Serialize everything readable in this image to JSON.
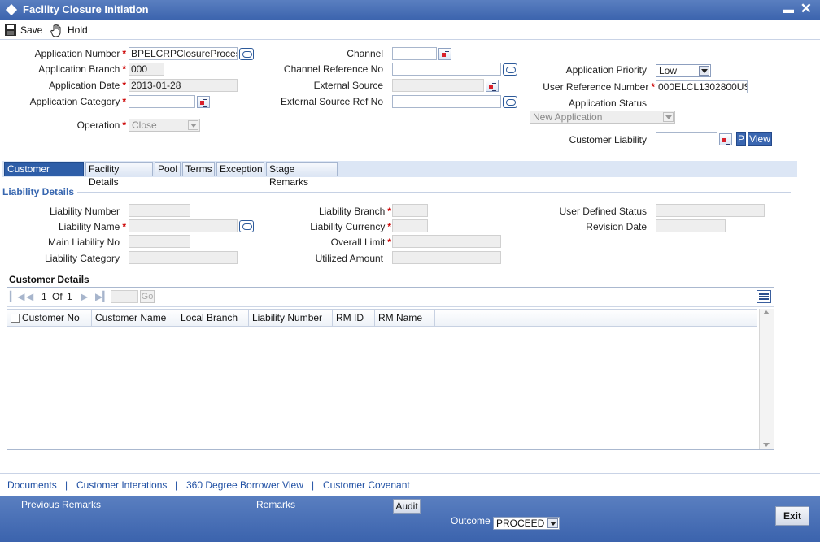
{
  "window": {
    "title": "Facility Closure Initiation"
  },
  "toolbar": {
    "save": "Save",
    "hold": "Hold"
  },
  "form": {
    "application_number": {
      "label": "Application Number",
      "value": "BPELCRPClosureProces"
    },
    "application_branch": {
      "label": "Application Branch",
      "value": "000"
    },
    "application_date": {
      "label": "Application Date",
      "value": "2013-01-28"
    },
    "application_category": {
      "label": "Application Category",
      "value": ""
    },
    "operation": {
      "label": "Operation",
      "value": "Close"
    },
    "channel": {
      "label": "Channel",
      "value": ""
    },
    "channel_reference_no": {
      "label": "Channel Reference No",
      "value": ""
    },
    "external_source": {
      "label": "External Source",
      "value": ""
    },
    "external_source_ref_no": {
      "label": "External Source Ref No",
      "value": ""
    },
    "application_priority": {
      "label": "Application Priority",
      "value": "Low"
    },
    "user_reference_number": {
      "label": "User Reference Number",
      "value": "000ELCL1302800US"
    },
    "application_status": {
      "label": "Application Status",
      "value": "New Application"
    },
    "customer_liability": {
      "label": "Customer Liability",
      "value": "",
      "p_button": "P",
      "view_button": "View"
    }
  },
  "tabs": [
    "Customer Details",
    "Facility Details",
    "Pool",
    "Terms",
    "Exception",
    "Stage Remarks"
  ],
  "liability": {
    "section_title": "Liability Details",
    "liability_number": "Liability Number",
    "liability_name": "Liability Name",
    "main_liability_no": "Main Liability No",
    "liability_category": "Liability Category",
    "liability_branch": "Liability Branch",
    "liability_currency": "Liability Currency",
    "overall_limit": "Overall Limit",
    "utilized_amount": "Utilized Amount",
    "user_defined_status": "User Defined Status",
    "revision_date": "Revision Date"
  },
  "customer_details": {
    "section_title": "Customer Details",
    "pager": {
      "page": "1",
      "of_label": "Of",
      "total": "1",
      "go": "Go"
    },
    "columns": [
      "Customer No",
      "Customer Name",
      "Local Branch",
      "Liability Number",
      "RM ID",
      "RM Name"
    ]
  },
  "footer_links": [
    "Documents",
    "Customer Interations",
    "360 Degree Borrower View",
    "Customer Covenant"
  ],
  "bottom": {
    "previous_remarks": "Previous Remarks",
    "remarks": "Remarks",
    "audit": "Audit",
    "outcome_label": "Outcome",
    "outcome_value": "PROCEED",
    "exit": "Exit"
  },
  "colors": {
    "title_bar": "#3b63ad",
    "active_tab": "#2e5ea8",
    "required": "#cc0000",
    "link": "#1f4fa3"
  }
}
